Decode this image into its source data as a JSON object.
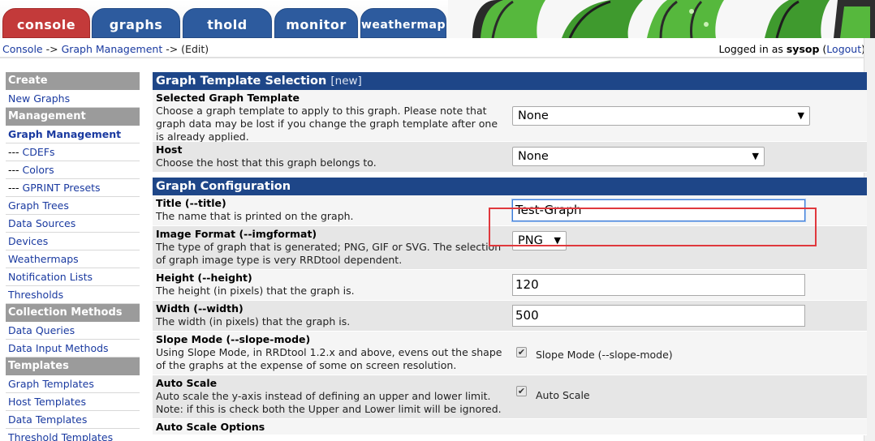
{
  "tabs": [
    {
      "label": "console"
    },
    {
      "label": "graphs"
    },
    {
      "label": "thold"
    },
    {
      "label": "monitor"
    },
    {
      "label": "weathermap"
    }
  ],
  "breadcrumb": {
    "console": "Console",
    "sep1": " -> ",
    "graph_management": "Graph Management",
    "sep2": " -> ",
    "edit": "(Edit)"
  },
  "login": {
    "prefix": "Logged in as ",
    "user": "sysop",
    "logout_open": " (",
    "logout": "Logout",
    "logout_close": ")"
  },
  "sidebar": {
    "sections": [
      {
        "head": "Create",
        "items": [
          {
            "label": "New Graphs"
          }
        ]
      },
      {
        "head": "Management",
        "items": [
          {
            "label": "Graph Management",
            "active": true
          },
          {
            "prefix": "--- ",
            "label": "CDEFs"
          },
          {
            "prefix": "--- ",
            "label": "Colors"
          },
          {
            "prefix": "--- ",
            "label": "GPRINT Presets"
          },
          {
            "label": "Graph Trees"
          },
          {
            "label": "Data Sources"
          },
          {
            "label": "Devices"
          },
          {
            "label": "Weathermaps"
          },
          {
            "label": "Notification Lists"
          },
          {
            "label": "Thresholds"
          }
        ]
      },
      {
        "head": "Collection Methods",
        "items": [
          {
            "label": "Data Queries"
          },
          {
            "label": "Data Input Methods"
          }
        ]
      },
      {
        "head": "Templates",
        "items": [
          {
            "label": "Graph Templates"
          },
          {
            "label": "Host Templates"
          },
          {
            "label": "Data Templates"
          },
          {
            "label": "Threshold Templates"
          }
        ]
      }
    ]
  },
  "template_section": {
    "title": "Graph Template Selection",
    "new_label": "[new]",
    "selected_template": {
      "title": "Selected Graph Template",
      "desc_line1": "Choose a graph template to apply to this graph. Please note that",
      "desc_line2": "graph data may be lost if you change the graph template after one",
      "desc_line3": "is already applied.",
      "value": "None"
    },
    "host": {
      "title": "Host",
      "desc": "Choose the host that this graph belongs to.",
      "value": "None"
    }
  },
  "config_section": {
    "title": "Graph Configuration",
    "title_field": {
      "title": "Title (--title)",
      "desc": "The name that is printed on the graph.",
      "value": "Test-Graph"
    },
    "image_format": {
      "title": "Image Format (--imgformat)",
      "desc_line1": "The type of graph that is generated; PNG, GIF or SVG. The selection",
      "desc_line2": "of graph image type is very RRDtool dependent.",
      "value": "PNG"
    },
    "height": {
      "title": "Height (--height)",
      "desc": "The height (in pixels) that the graph is.",
      "value": "120"
    },
    "width": {
      "title": "Width (--width)",
      "desc": "The width (in pixels) that the graph is.",
      "value": "500"
    },
    "slope_mode": {
      "title": "Slope Mode (--slope-mode)",
      "desc_line1": "Using Slope Mode, in RRDtool 1.2.x and above, evens out the shape",
      "desc_line2": "of the graphs at the expense of some on screen resolution.",
      "checkbox_label": "Slope Mode (--slope-mode)",
      "checked": true
    },
    "auto_scale": {
      "title": "Auto Scale",
      "desc_line1": "Auto scale the y-axis instead of defining an upper and lower limit.",
      "desc_line2": "Note: if this is check both the Upper and Lower limit will be ignored.",
      "checkbox_label": "Auto Scale",
      "checked": true
    },
    "auto_scale_options": {
      "title": "Auto Scale Options"
    }
  },
  "colors": {
    "header_blue": "#1e4688",
    "tab_red": "#c33a3a",
    "tab_blue": "#2d5b9e",
    "sidebar_head_gray": "#9b9b9b",
    "link_blue": "#1a3aa0",
    "highlight_red": "#e0383d"
  }
}
